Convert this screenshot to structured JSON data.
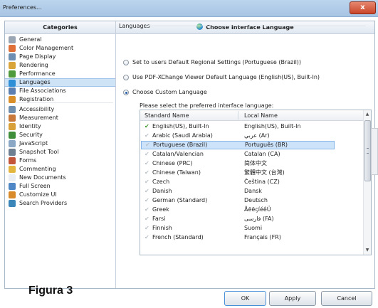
{
  "window": {
    "title": "Preferences...",
    "close_label": "x"
  },
  "categories": {
    "header": "Categories",
    "items": [
      {
        "label": "General",
        "icon": "general-icon",
        "color": "#9aa6b3"
      },
      {
        "label": "Color Management",
        "icon": "color-management-icon",
        "color": "#e0703a"
      },
      {
        "label": "Page Display",
        "icon": "page-display-icon",
        "color": "#6e8fb3"
      },
      {
        "label": "Rendering",
        "icon": "rendering-icon",
        "color": "#d9a43a"
      },
      {
        "label": "Performance",
        "icon": "performance-icon",
        "color": "#4f9a3a"
      },
      {
        "label": "Languages",
        "icon": "languages-icon",
        "color": "#2f8fd6"
      },
      {
        "label": "File Associations",
        "icon": "file-associations-icon",
        "color": "#5b7fb0"
      },
      {
        "label": "Registration",
        "icon": "registration-icon",
        "color": "#d98f2a"
      },
      {
        "label": "Accessibility",
        "icon": "accessibility-icon",
        "color": "#6f8fb0"
      },
      {
        "label": "Measurement",
        "icon": "measurement-icon",
        "color": "#c8783a"
      },
      {
        "label": "Identity",
        "icon": "identity-icon",
        "color": "#d9a03a"
      },
      {
        "label": "Security",
        "icon": "security-icon",
        "color": "#3f8f3a"
      },
      {
        "label": "JavaScript",
        "icon": "javascript-icon",
        "color": "#8aa7c6"
      },
      {
        "label": "Snapshot Tool",
        "icon": "snapshot-tool-icon",
        "color": "#6e7f92"
      },
      {
        "label": "Forms",
        "icon": "forms-icon",
        "color": "#c2553a"
      },
      {
        "label": "Commenting",
        "icon": "commenting-icon",
        "color": "#e3b640"
      },
      {
        "label": "New Documents",
        "icon": "new-documents-icon",
        "color": "#e9eef4"
      },
      {
        "label": "Full Screen",
        "icon": "full-screen-icon",
        "color": "#4f86c6"
      },
      {
        "label": "Customize UI",
        "icon": "customize-ui-icon",
        "color": "#d98a2a"
      },
      {
        "label": "Search Providers",
        "icon": "search-providers-icon",
        "color": "#3a86b8"
      }
    ],
    "selected": "Languages"
  },
  "panel": {
    "header": "Choose Interface Language",
    "section": "Languages",
    "options": [
      {
        "label": "Set to users Default Regional Settings (Portuguese (Brazil))",
        "selected": false
      },
      {
        "label": "Use PDF-XChange Viewer Default Language (English(US), Built-In)",
        "selected": false
      },
      {
        "label": "Choose Custom Language",
        "selected": true
      }
    ],
    "instruction": "Please select the preferred interface language:",
    "columns": {
      "standard": "Standard Name",
      "local": "Local Name"
    },
    "languages": [
      {
        "name": "English(US), Built-In",
        "local": "English(US), Built-In",
        "checked": true
      },
      {
        "name": "Arabic (Saudi Arabia)",
        "local": "عربي (Ar)",
        "checked": false
      },
      {
        "name": "Portuguese (Brazil)",
        "local": "Português (BR)",
        "checked": false,
        "selected": true
      },
      {
        "name": "Catalan/Valencian",
        "local": "Catalan (CA)",
        "checked": false
      },
      {
        "name": "Chinese (PRC)",
        "local": "简体中文",
        "checked": false
      },
      {
        "name": "Chinese (Taiwan)",
        "local": "繁體中文 (台灣)",
        "checked": false
      },
      {
        "name": "Czech",
        "local": "Čeština (CZ)",
        "checked": false
      },
      {
        "name": "Danish",
        "local": "Dansk",
        "checked": false
      },
      {
        "name": "German (Standard)",
        "local": "Deutsch",
        "checked": false
      },
      {
        "name": "Greek",
        "local": "ÅëëçíéêÜ",
        "checked": false
      },
      {
        "name": "Farsi",
        "local": "فارسی (FA)",
        "checked": false
      },
      {
        "name": "Finnish",
        "local": "Suomi",
        "checked": false
      },
      {
        "name": "French (Standard)",
        "local": "Français (FR)",
        "checked": false
      }
    ]
  },
  "caption": "Figura 3",
  "buttons": {
    "ok": "OK",
    "apply": "Apply",
    "cancel": "Cancel"
  }
}
